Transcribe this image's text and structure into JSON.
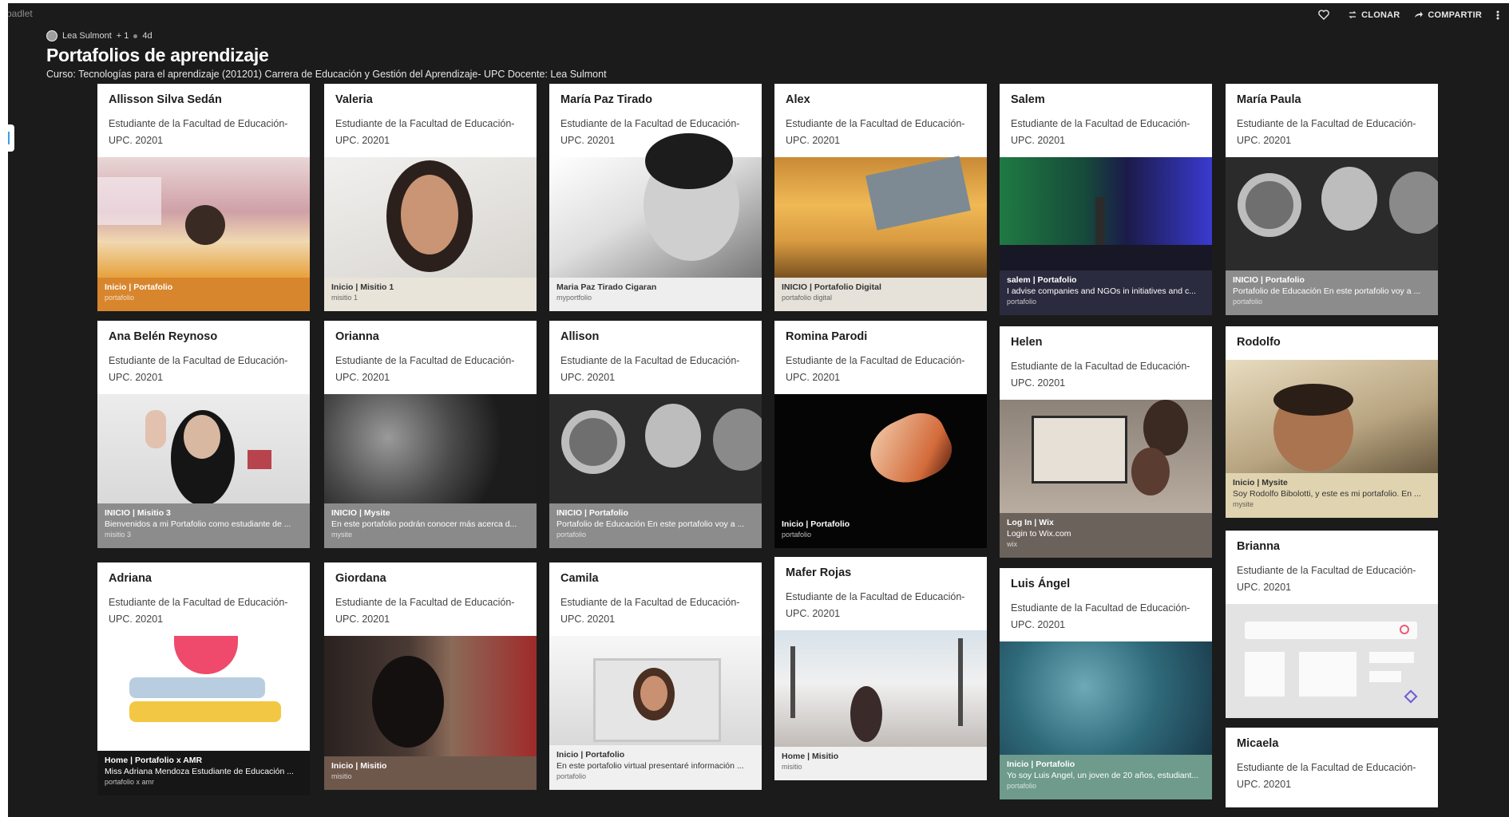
{
  "app": {
    "brand": "padlet"
  },
  "header": {
    "actions": [
      {
        "icon": "heart-icon",
        "label": ""
      },
      {
        "icon": "clone-icon",
        "label": "CLONAR"
      },
      {
        "icon": "share-icon",
        "label": "COMPARTIR"
      }
    ],
    "author": "Lea Sulmont",
    "likes": "+ 1",
    "age": "4d",
    "title": "Portafolios de aprendizaje",
    "subtitle": "Curso: Tecnologías para el aprendizaje (201201) Carrera de Educación y Gestión del Aprendizaje- UPC Docente: Lea Sulmont"
  },
  "columns": [
    [
      {
        "name": "Allisson Silva Sedán",
        "desc": "Estudiante de la Facultad de Educación- UPC. 20201",
        "footer": [
          "Inicio | Portafolio",
          "",
          "portafolio"
        ],
        "footer_color": "#d8862d",
        "image": "playroom"
      },
      {
        "name": "Ana Belén Reynoso",
        "desc": "Estudiante de la Facultad de Educación- UPC. 20201",
        "footer": [
          "INICIO | Misitio 3",
          "Bienvenidos a mi Portafolio como estudiante de ...",
          "misitio 3"
        ],
        "footer_color": "#8c8c8c",
        "image": "wave"
      },
      {
        "name": "Adriana",
        "desc": "Estudiante de la Facultad de Educación- UPC. 20201",
        "footer": [
          "Home | Portafolio x AMR",
          "Miss Adriana Mendoza Estudiante de Educación ...",
          "portafolio x amr"
        ],
        "footer_color": "#161616",
        "image": "books"
      }
    ],
    [
      {
        "name": "Valeria",
        "desc": "Estudiante de la Facultad de Educación- UPC. 20201",
        "footer": [
          "Inicio | Misitio 1",
          "",
          "misitio 1"
        ],
        "footer_color": "#e9e4da",
        "dark_text": true,
        "image": "portrait"
      },
      {
        "name": "Orianna",
        "desc": "Estudiante de la Facultad de Educación- UPC. 20201",
        "footer": [
          "INICIO | Mysite",
          "En este portafolio podrán conocer más acerca d...",
          "mysite"
        ],
        "footer_color": "#8a8a8a",
        "image": "blur"
      },
      {
        "name": "Giordana",
        "desc": "Estudiante de la Facultad de Educación- UPC. 20201",
        "footer": [
          "Inicio | Misitio",
          "",
          "misitio"
        ],
        "footer_color": "#6e574b",
        "image": "darkroom"
      }
    ],
    [
      {
        "name": "María Paz Tirado",
        "desc": "Estudiante de la Facultad de Educación- UPC. 20201",
        "footer": [
          "Maria Paz Tirado Cigaran",
          "",
          "myportfolio"
        ],
        "footer_color": "#eeeeee",
        "dark_text": true,
        "image": "bwsmile"
      },
      {
        "name": "Allison",
        "desc": "Estudiante de la Facultad de Educación- UPC. 20201",
        "footer": [
          "INICIO | Portafolio",
          "Portafolio de Educación En este portafolio voy a ...",
          "portafolio"
        ],
        "footer_color": "#8c8c8c",
        "image": "cc"
      },
      {
        "name": "Camila",
        "desc": "Estudiante de la Facultad de Educación- UPC. 20201",
        "footer": [
          "Inicio | Portafolio",
          "En este portafolio virtual presentaré información ...",
          "portafolio"
        ],
        "footer_color": "#f0f0f0",
        "dark_text": true,
        "image": "laptopgirl"
      }
    ],
    [
      {
        "name": "Alex",
        "desc": "Estudiante de la Facultad de Educación- UPC. 20201",
        "footer": [
          "INICIO | Portafolio Digital",
          "",
          "portafolio digital"
        ],
        "footer_color": "#e6e2da",
        "dark_text": true,
        "image": "wood"
      },
      {
        "name": "Romina Parodi",
        "desc": "Estudiante de la Facultad de Educación- UPC. 20201",
        "footer": [
          "Inicio | Portafolio",
          "",
          "portafolio"
        ],
        "footer_color": "#050505",
        "image": "hand"
      },
      {
        "name": "Mafer Rojas",
        "desc": "Estudiante de la Facultad de Educación- UPC. 20201",
        "footer": [
          "Home | Misitio",
          "",
          "misitio"
        ],
        "footer_color": "#f0f0f0",
        "dark_text": true,
        "image": "street"
      }
    ],
    [
      {
        "name": "Salem",
        "desc": "Estudiante de la Facultad de Educación- UPC. 20201",
        "footer": [
          "salem | Portafolio",
          "I advise companies and NGOs in initiatives and c...",
          "portafolio"
        ],
        "footer_color": "#2b2b3f",
        "image": "stage"
      },
      {
        "name": "Helen",
        "desc": "Estudiante de la Facultad de Educación- UPC. 20201",
        "footer": [
          "Log In | Wix",
          "Login to Wix.com",
          "wix"
        ],
        "footer_color": "#6b625c",
        "image": "office"
      },
      {
        "name": "Luis Ángel",
        "desc": "Estudiante de la Facultad de Educación- UPC. 20201",
        "footer": [
          "Inicio | Portafolio",
          "Yo soy Luis Angel, un joven de 20 años, estudiant...",
          "portafolio"
        ],
        "footer_color": "#6e9b8c",
        "image": "ocean"
      }
    ],
    [
      {
        "name": "María Paula",
        "desc": "Estudiante de la Facultad de Educación- UPC. 20201",
        "footer": [
          "INICIO | Portafolio",
          "Portafolio de Educación En este portafolio voy a ...",
          "portafolio"
        ],
        "footer_color": "#8c8c8c",
        "image": "cc"
      },
      {
        "name": "Rodolfo",
        "desc": "",
        "footer": [
          "Inicio | Mysite",
          "Soy Rodolfo Bibolotti, y este es mi portafolio. En ...",
          "mysite"
        ],
        "footer_color": "#e0d3b0",
        "dark_text": true,
        "image": "selfie"
      },
      {
        "name": "Brianna",
        "desc": "Estudiante de la Facultad de Educación- UPC. 20201",
        "footer": [
          "",
          "",
          ""
        ],
        "footer_color": "#e3e3e3",
        "dark_text": true,
        "image": "wireframe"
      },
      {
        "name": "Micaela",
        "desc": "Estudiante de la Facultad de Educación- UPC. 20201",
        "footer": [
          "",
          "",
          ""
        ],
        "footer_color": "#ffffff",
        "dark_text": true,
        "image": "none"
      }
    ]
  ]
}
